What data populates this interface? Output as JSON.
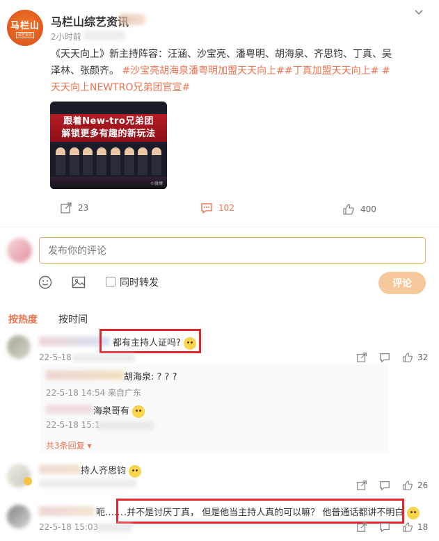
{
  "post": {
    "account_name": "马栏山综艺资讯",
    "avatar_text": "马栏山",
    "avatar_subtext": "综艺资讯",
    "time": "2小时前",
    "text_plain": "《天天向上》新主持阵容：汪涵、沙宝亮、潘粤明、胡海泉、齐思钧、丁真、吴泽林、张颜齐。",
    "tags": "#沙宝亮胡海泉潘粤明加盟天天向上##丁真加盟天天向上# #天天向上NEWTRO兄弟团官宣#",
    "image": {
      "headline_1": "跟着New-tro兄弟团",
      "headline_2": "解锁更多有趣的新玩法",
      "watermark": "©微博"
    },
    "actions": {
      "repost_count": "23",
      "comment_count": "102",
      "like_count": "400"
    }
  },
  "composer": {
    "placeholder": "发布你的评论",
    "repost_label": "同时转发",
    "submit_label": "评论"
  },
  "sort_tabs": {
    "hot": "按热度",
    "time": "按时间"
  },
  "comments": [
    {
      "text": "都有主持人证吗?",
      "meta": "22-5-18",
      "repost": "",
      "comment": "",
      "like": "32",
      "replies": [
        {
          "text": "胡海泉: ? ? ?",
          "meta": "22-5-18 14:54 来自广东"
        },
        {
          "text": "海泉哥有",
          "meta": "22-5-18 15:1"
        }
      ],
      "more_replies": "共3条回复"
    },
    {
      "text": "持人齐思钧",
      "like": "26"
    },
    {
      "text_prefix": "呃……",
      "text": ".并不是讨厌丁真， 但是他当主持人真的可以嘛？ 他普通话都讲不明白",
      "meta": "22-5-18 15:03",
      "like": "18"
    }
  ],
  "colors": {
    "accent": "#eb7350",
    "highlight_border": "#e3262c",
    "input_border": "#f1ac5f",
    "submit_bg": "#f6c99c"
  }
}
